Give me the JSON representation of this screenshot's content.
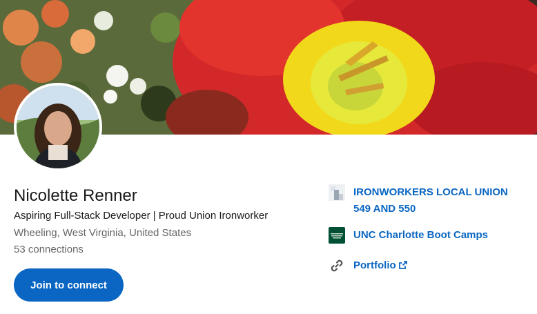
{
  "profile": {
    "name": "Nicolette Renner",
    "headline": "Aspiring Full-Stack Developer | Proud Union Ironworker",
    "location": "Wheeling, West Virginia, United States",
    "connections": "53 connections"
  },
  "actions": {
    "join_label": "Join to connect"
  },
  "sidebar": {
    "items": [
      {
        "label": "IRONWORKERS LOCAL UNION 549 AND 550",
        "icon": "company-logo-icon"
      },
      {
        "label": "UNC Charlotte Boot Camps",
        "icon": "school-logo-icon"
      },
      {
        "label": "Portfolio",
        "icon": "link-icon",
        "external_icon": "external-link-icon"
      }
    ]
  },
  "colors": {
    "accent": "#0a66c2",
    "text_primary": "#191919",
    "text_secondary": "#666666"
  }
}
